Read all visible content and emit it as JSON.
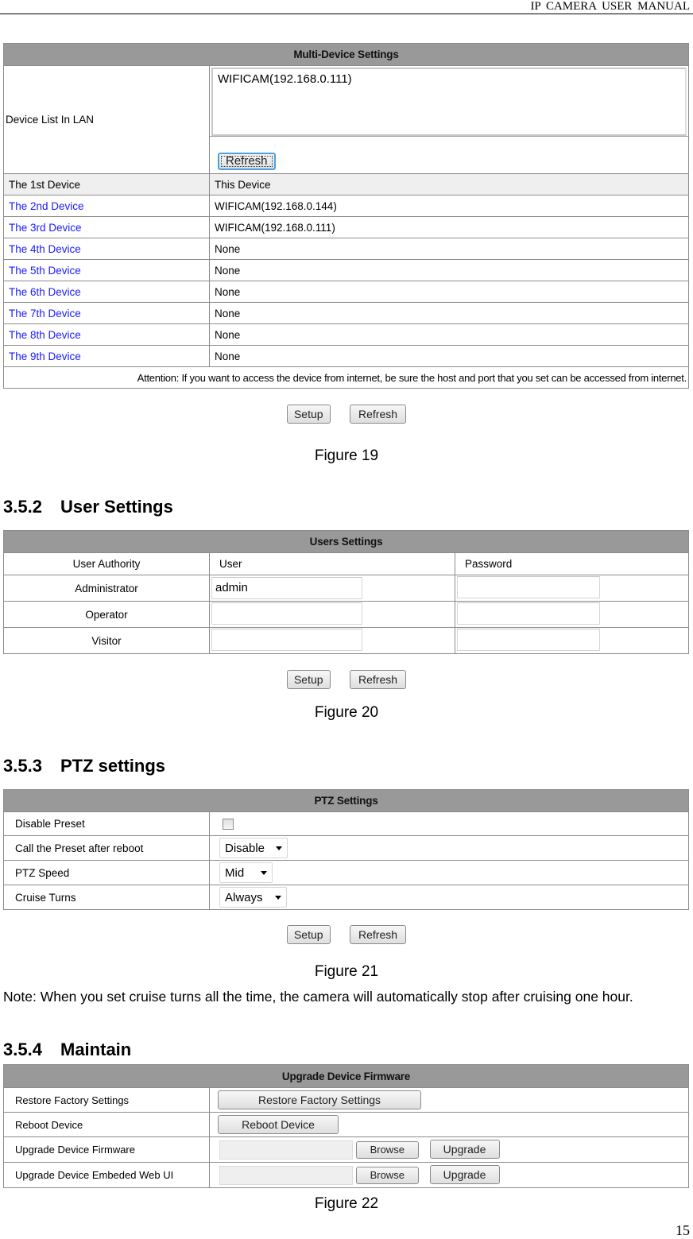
{
  "page": {
    "running_header": "IP CAMERA USER MANUAL",
    "page_number": "15"
  },
  "figure19": {
    "table_title": "Multi-Device Settings",
    "device_list_label": "Device List In LAN",
    "device_list_items": [
      "WIFICAM(192.168.0.111)"
    ],
    "device_list_refresh": "Refresh",
    "devices": [
      {
        "label": "The 1st Device",
        "value": "This Device"
      },
      {
        "label": "The 2nd Device",
        "value": "WIFICAM(192.168.0.144)"
      },
      {
        "label": "The 3rd Device",
        "value": "WIFICAM(192.168.0.111)"
      },
      {
        "label": "The 4th Device",
        "value": "None"
      },
      {
        "label": "The 5th Device",
        "value": "None"
      },
      {
        "label": "The 6th Device",
        "value": "None"
      },
      {
        "label": "The 7th Device",
        "value": "None"
      },
      {
        "label": "The 8th Device",
        "value": "None"
      },
      {
        "label": "The 9th Device",
        "value": "None"
      }
    ],
    "attention": "Attention: If you want to access the device from internet, be sure the host and port that you set can be accessed from internet.",
    "setup_label": "Setup",
    "refresh_label": "Refresh",
    "caption": "Figure 19",
    "link_color": "#1a1aff"
  },
  "section_352": {
    "number": "3.5.2",
    "title": "User Settings"
  },
  "figure20": {
    "table_title": "Users Settings",
    "columns": [
      "User Authority",
      "User",
      "Password"
    ],
    "rows": [
      {
        "authority": "Administrator",
        "user": "admin",
        "password": ""
      },
      {
        "authority": "Operator",
        "user": "",
        "password": ""
      },
      {
        "authority": "Visitor",
        "user": "",
        "password": ""
      }
    ],
    "setup_label": "Setup",
    "refresh_label": "Refresh",
    "caption": "Figure 20"
  },
  "section_353": {
    "number": "3.5.3",
    "title": "PTZ settings"
  },
  "figure21": {
    "table_title": "PTZ Settings",
    "disable_preset_label": "Disable Preset",
    "disable_preset_checked": false,
    "call_preset_label": "Call the Preset after reboot",
    "call_preset_value": "Disable",
    "ptz_speed_label": "PTZ Speed",
    "ptz_speed_value": "Mid",
    "cruise_turns_label": "Cruise Turns",
    "cruise_turns_value": "Always",
    "setup_label": "Setup",
    "refresh_label": "Refresh",
    "caption": "Figure 21"
  },
  "note": "Note: When you set cruise turns all the time, the camera will automatically stop after cruising one hour.",
  "section_354": {
    "number": "3.5.4",
    "title": "Maintain"
  },
  "figure22": {
    "table_title": "Upgrade Device Firmware",
    "restore_label": "Restore Factory Settings",
    "restore_button": "Restore Factory Settings",
    "reboot_label": "Reboot Device",
    "reboot_button": "Reboot Device",
    "upgrade_fw_label": "Upgrade Device Firmware",
    "upgrade_ui_label": "Upgrade Device Embeded Web UI",
    "browse_label": "Browse",
    "upgrade_label": "Upgrade",
    "caption": "Figure 22"
  }
}
